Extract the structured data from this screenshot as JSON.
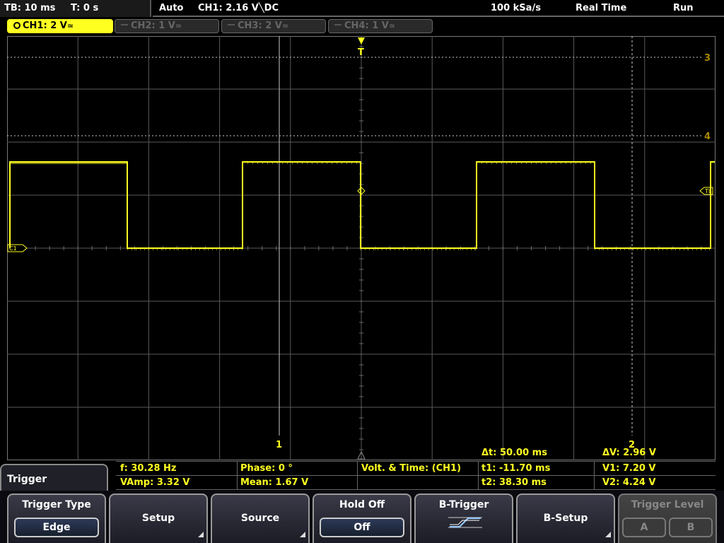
{
  "topbar": {
    "timebase": "TB: 10 ms",
    "trigger_time": "T: 0 s",
    "mode": "Auto",
    "trigger_source": "CH1: 2.16 V",
    "trigger_slope_coupling": "╲DC",
    "sample_rate": "100 kSa/s",
    "acquisition": "Real Time",
    "run_state": "Run"
  },
  "channels": [
    {
      "label": "CH1: 2 V",
      "coupling": "≃",
      "active": true
    },
    {
      "label": "CH2: 1 V",
      "coupling": "≃",
      "active": false
    },
    {
      "label": "CH3: 2 V",
      "coupling": "≃",
      "active": false
    },
    {
      "label": "CH4: 1 V",
      "coupling": "≃",
      "active": false
    }
  ],
  "colors": {
    "ch1": "#ffff20",
    "grid": "#5a5a5a",
    "cursor": "#c8c8c8"
  },
  "markers": {
    "trigger": "T",
    "cursor1": "1",
    "cursor2": "2",
    "ref3": "3",
    "ref4": "4",
    "trigger_level": "TL",
    "ch1_ground": "C1"
  },
  "measurements": {
    "delta_t": "Δt: 50.00 ms",
    "delta_v": "ΔV: 2.96 V",
    "frequency": "f: 30.28 Hz",
    "phase": "Phase: 0 °",
    "mode": "Volt. & Time:  (CH1)",
    "t1": "t1: -11.70 ms",
    "v1": "V1: 7.20 V",
    "vamp": "VAmp: 3.32 V",
    "mean": "Mean: 1.67 V",
    "t2": "t2: 38.30 ms",
    "v2": "V2: 4.24 V"
  },
  "menu": {
    "title": "Trigger",
    "softkeys": [
      {
        "label": "Trigger Type",
        "value": "Edge"
      },
      {
        "label": "Setup"
      },
      {
        "label": "Source"
      },
      {
        "label": "Hold Off",
        "value": "Off"
      },
      {
        "label": "B-Trigger",
        "icon": "b-trigger-icon"
      },
      {
        "label": "B-Setup"
      },
      {
        "label": "Trigger Level",
        "a": "A",
        "b": "B",
        "disabled": true
      }
    ]
  }
}
